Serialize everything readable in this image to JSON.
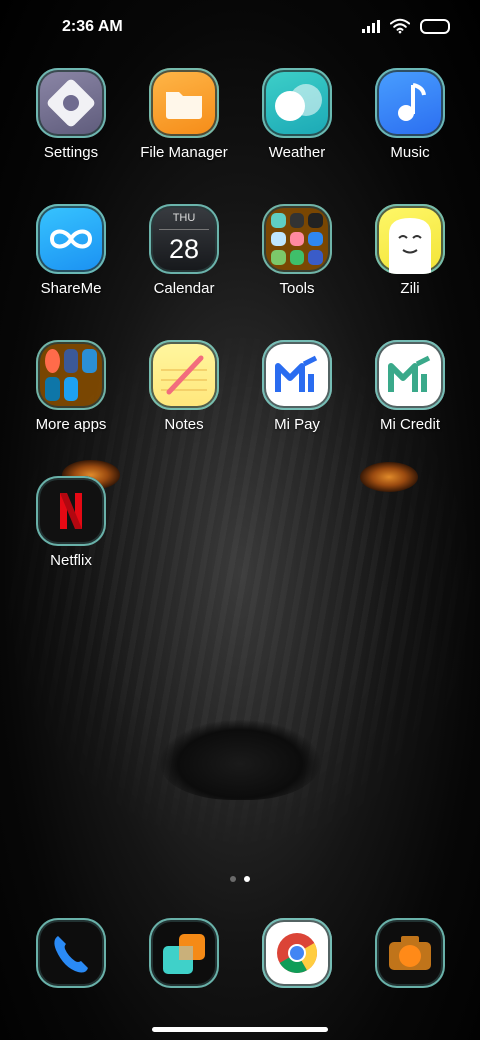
{
  "status_bar": {
    "time": "2:36 AM"
  },
  "apps": {
    "settings": "Settings",
    "file_manager": "File Manager",
    "weather": "Weather",
    "music": "Music",
    "shareme": "ShareMe",
    "calendar": "Calendar",
    "tools": "Tools",
    "zili": "Zili",
    "more_apps": "More apps",
    "notes": "Notes",
    "mi_pay": "Mi Pay",
    "mi_credit": "Mi Credit",
    "netflix": "Netflix"
  },
  "calendar_icon": {
    "weekday": "THU",
    "day": "28"
  },
  "dock": [
    "phone",
    "gallery",
    "chrome",
    "camera"
  ],
  "page_indicator": {
    "pages": 2,
    "current": 2
  },
  "colors": {
    "accent_outline": "#82dcd2",
    "folder_bg": "#8c5000"
  }
}
